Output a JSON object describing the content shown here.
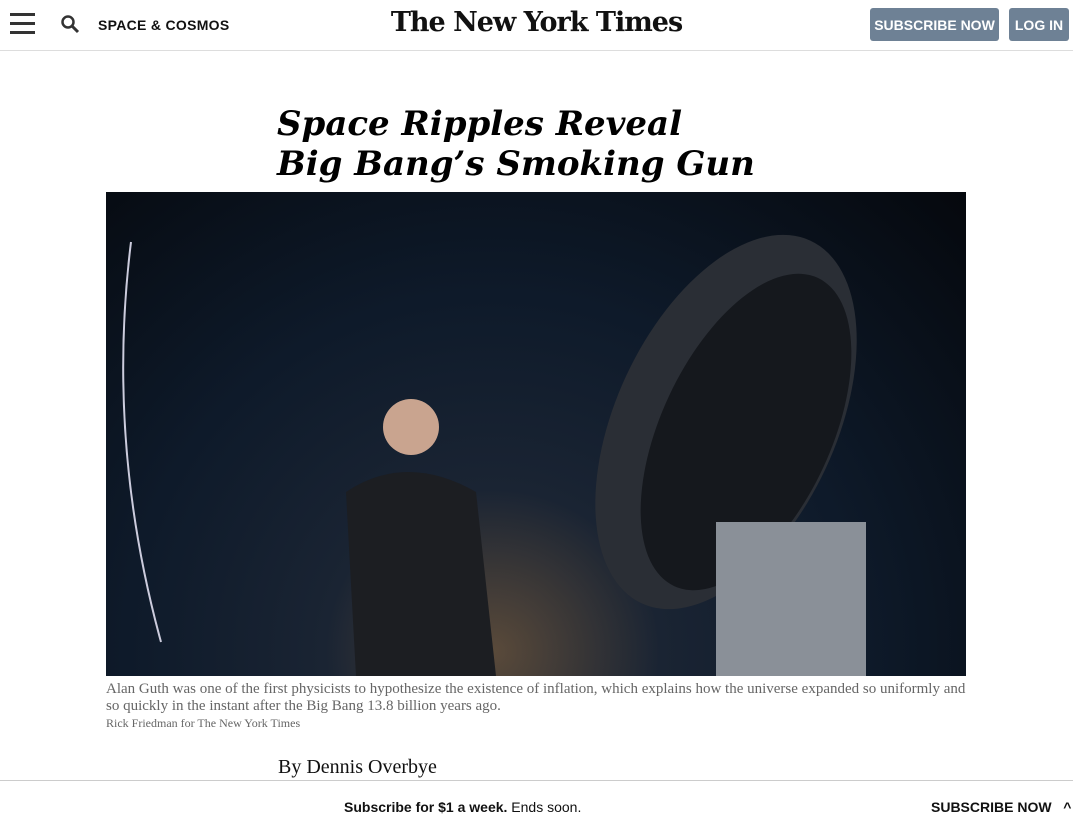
{
  "header": {
    "section": "SPACE & COSMOS",
    "logo": "The New York Times",
    "subscribe": "SUBSCRIBE NOW",
    "login": "LOG IN"
  },
  "article": {
    "headline_line1": "Space Ripples Reveal",
    "headline_line2": "Big Bang’s Smoking Gun",
    "caption": "Alan Guth was one of the first physicists to hypothesize the existence of inflation, which explains how the universe expanded so uniformly and so quickly in the instant after the Big Bang 13.8 billion years ago.",
    "credit": "Rick Friedman for The New York Times",
    "byline": "By Dennis Overbye"
  },
  "footer_bar": {
    "promo_bold": "Subscribe for $1 a week.",
    "promo_rest": " Ends soon.",
    "subscribe": "SUBSCRIBE NOW",
    "chevron": "^"
  }
}
